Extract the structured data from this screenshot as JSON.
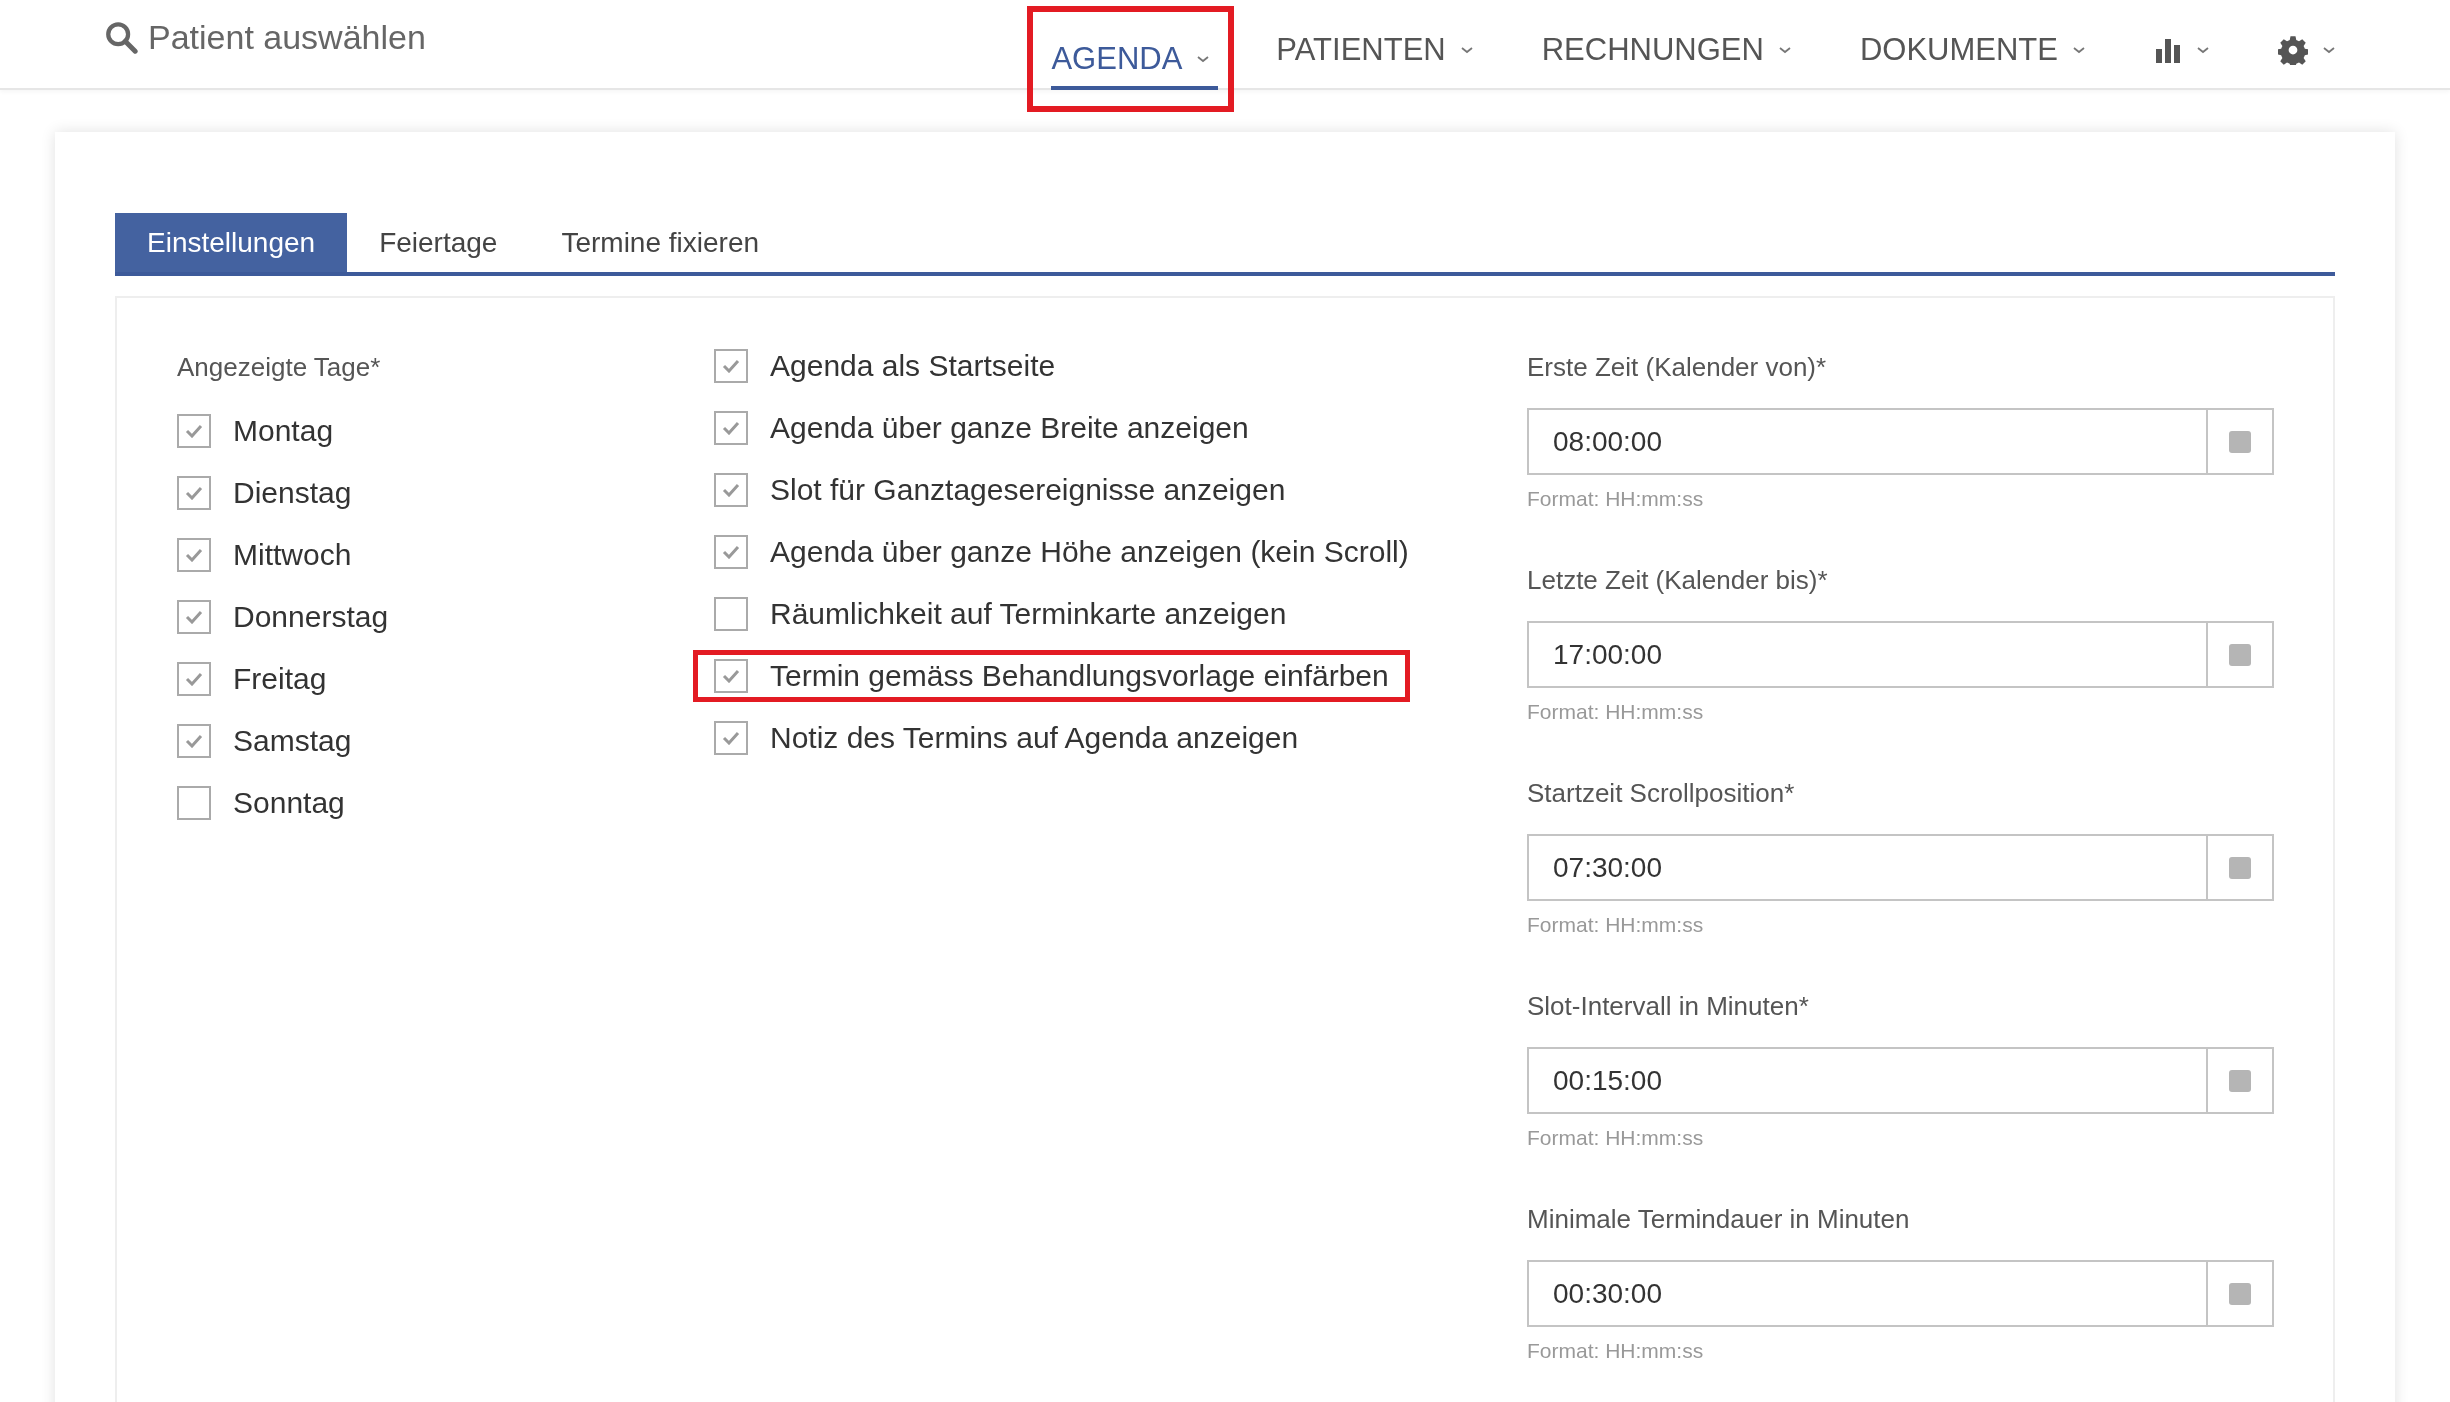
{
  "search": {
    "placeholder": "Patient auswählen"
  },
  "nav": [
    {
      "kind": "text",
      "label": "AGENDA",
      "selected": true,
      "highlighted": true
    },
    {
      "kind": "text",
      "label": "PATIENTEN",
      "selected": false,
      "highlighted": false
    },
    {
      "kind": "text",
      "label": "RECHNUNGEN",
      "selected": false,
      "highlighted": false
    },
    {
      "kind": "text",
      "label": "DOKUMENTE",
      "selected": false,
      "highlighted": false
    },
    {
      "kind": "chart",
      "selected": false,
      "highlighted": false
    },
    {
      "kind": "gear",
      "selected": false,
      "highlighted": false
    }
  ],
  "tabs": [
    {
      "label": "Einstellungen",
      "selected": true
    },
    {
      "label": "Feiertage",
      "selected": false
    },
    {
      "label": "Termine fixieren",
      "selected": false
    }
  ],
  "days": {
    "label": "Angezeigte Tage*",
    "items": [
      {
        "label": "Montag",
        "checked": true
      },
      {
        "label": "Dienstag",
        "checked": true
      },
      {
        "label": "Mittwoch",
        "checked": true
      },
      {
        "label": "Donnerstag",
        "checked": true
      },
      {
        "label": "Freitag",
        "checked": true
      },
      {
        "label": "Samstag",
        "checked": true
      },
      {
        "label": "Sonntag",
        "checked": false
      }
    ]
  },
  "options": [
    {
      "label": "Agenda als Startseite",
      "checked": true,
      "highlighted": false
    },
    {
      "label": "Agenda über ganze Breite anzeigen",
      "checked": true,
      "highlighted": false
    },
    {
      "label": "Slot für Ganztagesereignisse anzeigen",
      "checked": true,
      "highlighted": false
    },
    {
      "label": "Agenda über ganze Höhe anzeigen (kein Scroll)",
      "checked": true,
      "highlighted": false
    },
    {
      "label": "Räumlichkeit auf Terminkarte anzeigen",
      "checked": false,
      "highlighted": false
    },
    {
      "label": "Termin gemäss Behandlungsvorlage einfärben",
      "checked": true,
      "highlighted": true
    },
    {
      "label": "Notiz des Termins auf Agenda anzeigen",
      "checked": true,
      "highlighted": false
    }
  ],
  "time_fields": [
    {
      "label": "Erste Zeit (Kalender von)*",
      "value": "08:00:00",
      "hint": "Format: HH:mm:ss"
    },
    {
      "label": "Letzte Zeit (Kalender bis)*",
      "value": "17:00:00",
      "hint": "Format: HH:mm:ss"
    },
    {
      "label": "Startzeit Scrollposition*",
      "value": "07:30:00",
      "hint": "Format: HH:mm:ss"
    },
    {
      "label": "Slot-Intervall in Minuten*",
      "value": "00:15:00",
      "hint": "Format: HH:mm:ss"
    },
    {
      "label": "Minimale Termindauer in Minuten",
      "value": "00:30:00",
      "hint": "Format: HH:mm:ss"
    }
  ]
}
